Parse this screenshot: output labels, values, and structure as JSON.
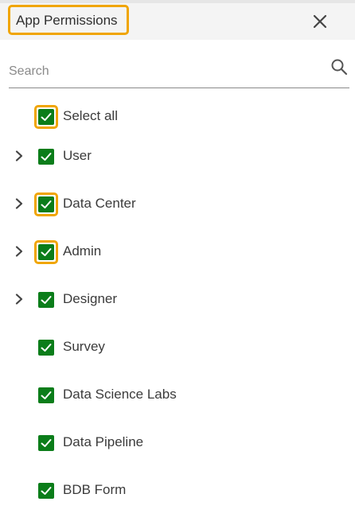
{
  "dialog": {
    "title": "App Permissions",
    "close_icon": "close-icon"
  },
  "search": {
    "placeholder": "Search",
    "value": "",
    "icon": "search-icon"
  },
  "tree": {
    "select_all": {
      "label": "Select all",
      "checked": true,
      "highlighted": true
    },
    "items": [
      {
        "label": "User",
        "checked": true,
        "expandable": true,
        "highlighted": false
      },
      {
        "label": "Data Center",
        "checked": true,
        "expandable": true,
        "highlighted": true
      },
      {
        "label": "Admin",
        "checked": true,
        "expandable": true,
        "highlighted": true
      },
      {
        "label": "Designer",
        "checked": true,
        "expandable": true,
        "highlighted": false
      },
      {
        "label": "Survey",
        "checked": true,
        "expandable": false,
        "highlighted": false
      },
      {
        "label": "Data Science Labs",
        "checked": true,
        "expandable": false,
        "highlighted": false
      },
      {
        "label": "Data Pipeline",
        "checked": true,
        "expandable": false,
        "highlighted": false
      },
      {
        "label": "BDB Form",
        "checked": true,
        "expandable": false,
        "highlighted": false
      }
    ]
  },
  "colors": {
    "checkbox_fill": "#0b7d1a",
    "highlight_outline": "#f0a500",
    "header_bg": "#f4f4f4"
  }
}
